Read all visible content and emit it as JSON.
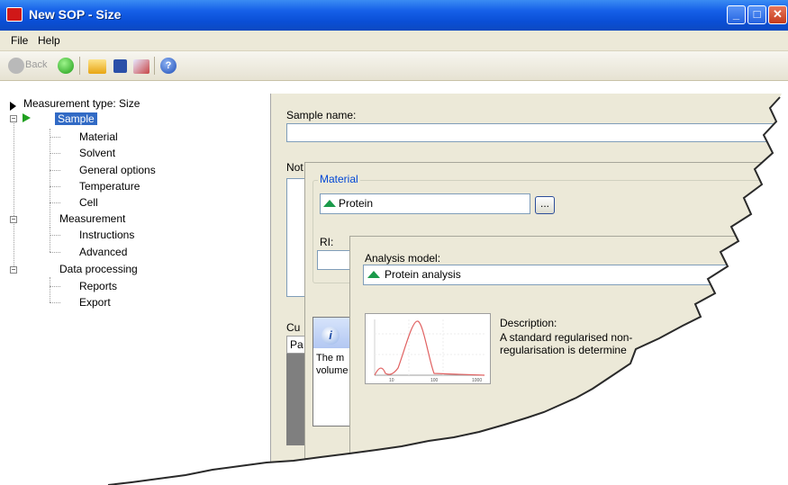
{
  "window": {
    "title": "New SOP - Size",
    "min_glyph": "_",
    "max_glyph": "□",
    "close_glyph": "✕"
  },
  "menu": {
    "file_label": "File",
    "help_label": "Help"
  },
  "toolbar": {
    "back_label": "Back",
    "help_glyph": "?"
  },
  "tree": {
    "root": "Measurement type: Size",
    "sample": "Sample",
    "sample_children": [
      "Material",
      "Solvent",
      "General options",
      "Temperature",
      "Cell"
    ],
    "measurement": "Measurement",
    "measurement_children": [
      "Instructions",
      "Advanced"
    ],
    "data_processing": "Data processing",
    "data_processing_children": [
      "Reports",
      "Export"
    ]
  },
  "sample_pane": {
    "name_label": "Sample name:",
    "name_value": "",
    "notes_label": "Not",
    "cu_label": "Cu",
    "pa_label": "Pa"
  },
  "material_panel": {
    "group_label": "Material",
    "material_value": "Protein",
    "browse_label": "...",
    "ri_label": "RI:"
  },
  "tooltip": {
    "info_glyph": "i",
    "line1": "The m",
    "line2": "volume"
  },
  "analysis_panel": {
    "model_label": "Analysis model:",
    "model_value": "Protein analysis",
    "description_label": "Description:",
    "description_line1": "A standard regularised non-",
    "description_line2": "regularisation is determine",
    "graph_ticks": [
      "10",
      "100",
      "1000"
    ]
  }
}
